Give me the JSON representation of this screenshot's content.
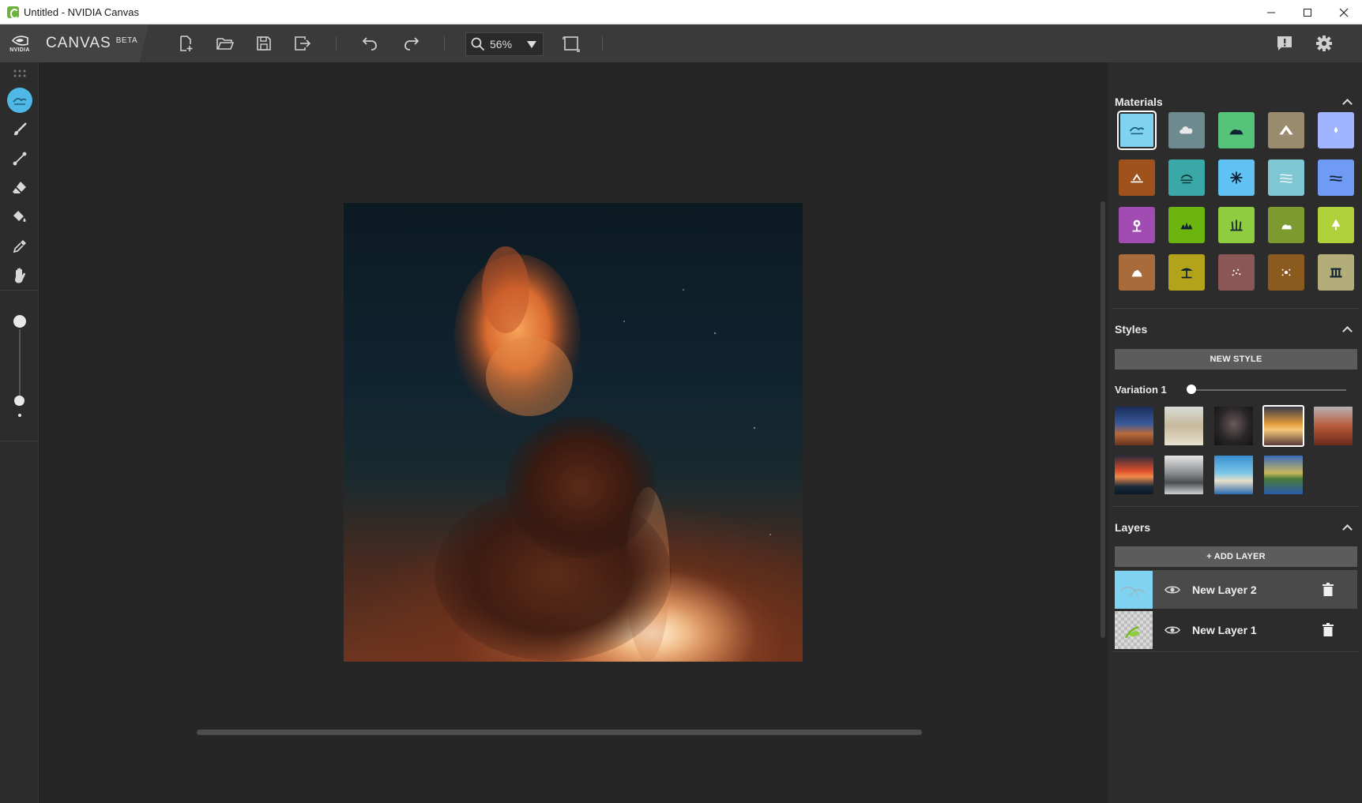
{
  "window": {
    "title": "Untitled - NVIDIA Canvas",
    "controls": [
      "minimize",
      "maximize",
      "close"
    ]
  },
  "brand": {
    "logo_text": "NVIDIA",
    "app_name": "CANVAS",
    "badge": "BETA"
  },
  "toolbar": {
    "buttons": [
      "new-file-icon",
      "open-folder-icon",
      "save-icon",
      "export-icon",
      "undo-icon",
      "redo-icon",
      "fit-to-screen-icon",
      "feedback-icon",
      "settings-icon"
    ],
    "zoom": {
      "value": "56%",
      "icon": "magnifier-icon"
    }
  },
  "tools": [
    {
      "name": "material-brush",
      "icon": "landscape-brush-icon",
      "active": true
    },
    {
      "name": "brush",
      "icon": "paintbrush-icon",
      "active": false
    },
    {
      "name": "line",
      "icon": "line-tool-icon",
      "active": false
    },
    {
      "name": "eraser",
      "icon": "eraser-icon",
      "active": false
    },
    {
      "name": "fill",
      "icon": "paint-bucket-icon",
      "active": false
    },
    {
      "name": "eyedropper",
      "icon": "eyedropper-icon",
      "active": false
    },
    {
      "name": "pan",
      "icon": "hand-icon",
      "active": false
    }
  ],
  "brush_size": {
    "level": 0.95
  },
  "materials": {
    "title": "Materials",
    "tiles": [
      {
        "name": "sky",
        "color": "#7fd3f0",
        "icon": "sky-icon",
        "selected": true
      },
      {
        "name": "cloud",
        "color": "#6d8a8f",
        "icon": "cloud-icon"
      },
      {
        "name": "hill",
        "color": "#55c47a",
        "icon": "hill-icon"
      },
      {
        "name": "mountain",
        "color": "#9a8a6e",
        "icon": "mountain-icon"
      },
      {
        "name": "water-drop",
        "color": "#a0b4ff",
        "icon": "water-drop-icon"
      },
      {
        "name": "dirt",
        "color": "#a0521d",
        "icon": "dirt-icon"
      },
      {
        "name": "fog",
        "color": "#3aa8a6",
        "icon": "fog-icon"
      },
      {
        "name": "snow",
        "color": "#5fc2f3",
        "icon": "snowflake-icon"
      },
      {
        "name": "river",
        "color": "#7fc7d2",
        "icon": "river-icon"
      },
      {
        "name": "sea",
        "color": "#6f9bf5",
        "icon": "sea-icon"
      },
      {
        "name": "flower",
        "color": "#a04cb3",
        "icon": "flower-icon"
      },
      {
        "name": "grass",
        "color": "#6cb50f",
        "icon": "grass-icon"
      },
      {
        "name": "tall-grass",
        "color": "#8fcc3f",
        "icon": "tall-grass-icon"
      },
      {
        "name": "bush",
        "color": "#7d9a30",
        "icon": "bush-icon"
      },
      {
        "name": "tree",
        "color": "#b0d13a",
        "icon": "tree-icon"
      },
      {
        "name": "rock",
        "color": "#a86c3c",
        "icon": "rock-icon"
      },
      {
        "name": "palm",
        "color": "#b3a31a",
        "icon": "palm-icon"
      },
      {
        "name": "gravel",
        "color": "#8a5656",
        "icon": "gravel-icon"
      },
      {
        "name": "sand",
        "color": "#8a5a1e",
        "icon": "sand-icon"
      },
      {
        "name": "building",
        "color": "#b3ad7a",
        "icon": "building-icon"
      }
    ]
  },
  "styles": {
    "title": "Styles",
    "new_style_label": "NEW STYLE",
    "variation_label": "Variation 1",
    "variation_level": 0.0,
    "thumbs": [
      {
        "name": "desert-night",
        "selected": false
      },
      {
        "name": "snowy-rocks",
        "selected": false
      },
      {
        "name": "starry-arch",
        "selected": false
      },
      {
        "name": "sunset-clouds",
        "selected": true
      },
      {
        "name": "red-cliffs",
        "selected": false
      },
      {
        "name": "ocean-sunset",
        "selected": false
      },
      {
        "name": "foggy-peaks",
        "selected": false
      },
      {
        "name": "tropical-coast",
        "selected": false
      },
      {
        "name": "lake-reflection",
        "selected": false
      }
    ]
  },
  "layers": {
    "title": "Layers",
    "add_label": "+ ADD LAYER",
    "items": [
      {
        "name": "New Layer 2",
        "active": true
      },
      {
        "name": "New Layer 1",
        "active": false
      }
    ]
  }
}
